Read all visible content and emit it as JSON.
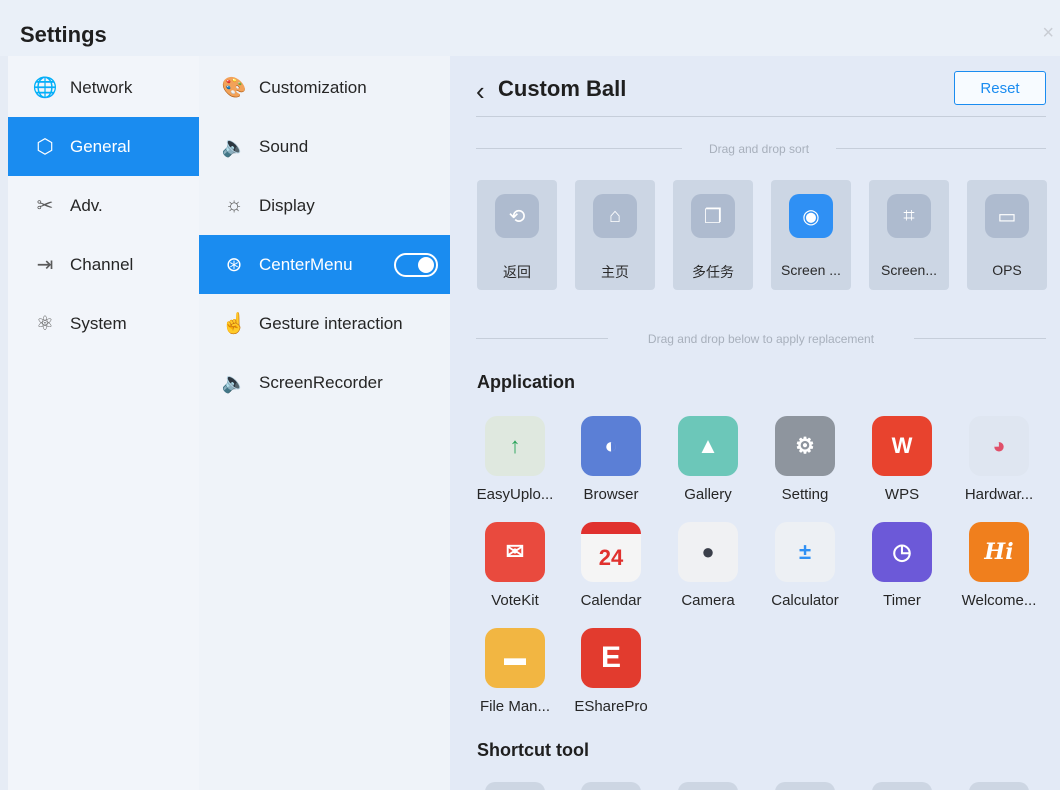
{
  "window": {
    "title": "Settings",
    "close_glyph": "×"
  },
  "sidebar": {
    "items": [
      {
        "label": "Network",
        "icon": "globe-icon",
        "glyph": "🌐",
        "active": false
      },
      {
        "label": "General",
        "icon": "cube-icon",
        "glyph": "⬡",
        "active": true
      },
      {
        "label": "Adv.",
        "icon": "tools-icon",
        "glyph": "✂",
        "active": false
      },
      {
        "label": "Channel",
        "icon": "input-icon",
        "glyph": "⇥",
        "active": false
      },
      {
        "label": "System",
        "icon": "atom-icon",
        "glyph": "⚛",
        "active": false
      }
    ]
  },
  "submenu": {
    "items": [
      {
        "label": "Customization",
        "icon": "palette-icon",
        "glyph": "🎨"
      },
      {
        "label": "Sound",
        "icon": "speaker-icon",
        "glyph": "🔈"
      },
      {
        "label": "Display",
        "icon": "sun-icon",
        "glyph": "☼"
      },
      {
        "label": "CenterMenu",
        "icon": "centermenu-icon",
        "glyph": "⊛",
        "active": true,
        "toggle_on": true
      },
      {
        "label": "Gesture interaction",
        "icon": "hand-icon",
        "glyph": "☝"
      },
      {
        "label": "ScreenRecorder",
        "icon": "speaker-icon",
        "glyph": "🔈"
      }
    ]
  },
  "main": {
    "back_glyph": "‹",
    "title": "Custom Ball",
    "reset_label": "Reset",
    "sort_hint": "Drag and drop sort",
    "replace_hint": "Drag and drop below to apply replacement",
    "tiles": [
      {
        "label": "返回",
        "icon": "back-circle-icon",
        "glyph": "⟲",
        "highlight": false
      },
      {
        "label": "主页",
        "icon": "home-icon",
        "glyph": "⌂",
        "highlight": false
      },
      {
        "label": "多任务",
        "icon": "multitask-icon",
        "glyph": "❐",
        "highlight": false
      },
      {
        "label": "Screen ...",
        "icon": "record-icon",
        "glyph": "◉",
        "highlight": true
      },
      {
        "label": "Screen...",
        "icon": "crop-icon",
        "glyph": "⌗",
        "highlight": false
      },
      {
        "label": "OPS",
        "icon": "ops-icon",
        "glyph": "▭",
        "highlight": false
      }
    ],
    "application_title": "Application",
    "apps": [
      {
        "label": "EasyUplo...",
        "icon": "easyupload-icon",
        "glyph": "↑",
        "color": "#dfe8df"
      },
      {
        "label": "Browser",
        "icon": "browser-icon",
        "glyph": "◐",
        "color": "#5b7fd6"
      },
      {
        "label": "Gallery",
        "icon": "gallery-icon",
        "glyph": "▲",
        "color": "#6cc7b9"
      },
      {
        "label": "Setting",
        "icon": "setting-icon",
        "glyph": "⚙",
        "color": "#8e959e"
      },
      {
        "label": "WPS",
        "icon": "wps-icon",
        "glyph": "W",
        "color": "#e8432e"
      },
      {
        "label": "Hardwar...",
        "icon": "hardware-icon",
        "glyph": "◕",
        "color": "#dfe6f1"
      },
      {
        "label": "VoteKit",
        "icon": "votekit-icon",
        "glyph": "✉",
        "color": "#e94a3e"
      },
      {
        "label": "Calendar",
        "icon": "calendar-icon",
        "glyph": "24",
        "color": "#f5f5f5"
      },
      {
        "label": "Camera",
        "icon": "camera-icon",
        "glyph": "●",
        "color": "#f0f1f3"
      },
      {
        "label": "Calculator",
        "icon": "calculator-icon",
        "glyph": "±",
        "color": "#edf0f4"
      },
      {
        "label": "Timer",
        "icon": "timer-icon",
        "glyph": "◷",
        "color": "#6c59d8"
      },
      {
        "label": "Welcome...",
        "icon": "welcome-icon",
        "glyph": "Hi",
        "color": "#f07f1d"
      },
      {
        "label": "File Man...",
        "icon": "folder-icon",
        "glyph": "▬",
        "color": "#f2b642"
      },
      {
        "label": "ESharePro",
        "icon": "eshare-icon",
        "glyph": "E",
        "color": "#e23b2e"
      }
    ],
    "shortcut_title": "Shortcut tool"
  }
}
